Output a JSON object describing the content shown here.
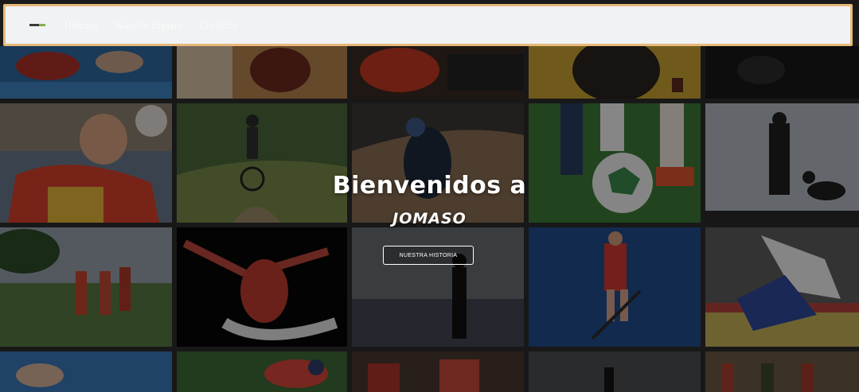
{
  "nav": {
    "logo_icon": "jomaso-logo-icon",
    "links": [
      "Noticias",
      "Nuestro Equipo",
      "Contacto"
    ],
    "border_color": "#e7b97a",
    "background": "#f1f2f4"
  },
  "hero": {
    "title": "Bienvenidos a",
    "subtitle": "JOMASO",
    "button_label": "NUESTRA HISTORIA"
  },
  "gallery": {
    "rows": 4,
    "columns": 5,
    "tiles": [
      "swimming",
      "boxing",
      "motocross",
      "sprint-start",
      "dark-scene",
      "handball",
      "mountain-bike",
      "bmx",
      "football",
      "hunter-with-dog",
      "running",
      "gymnastics",
      "surf-silhouette",
      "field-hockey",
      "judo",
      "swimming-2",
      "cycling",
      "crowd",
      "dark-scene-2",
      "runners"
    ]
  }
}
